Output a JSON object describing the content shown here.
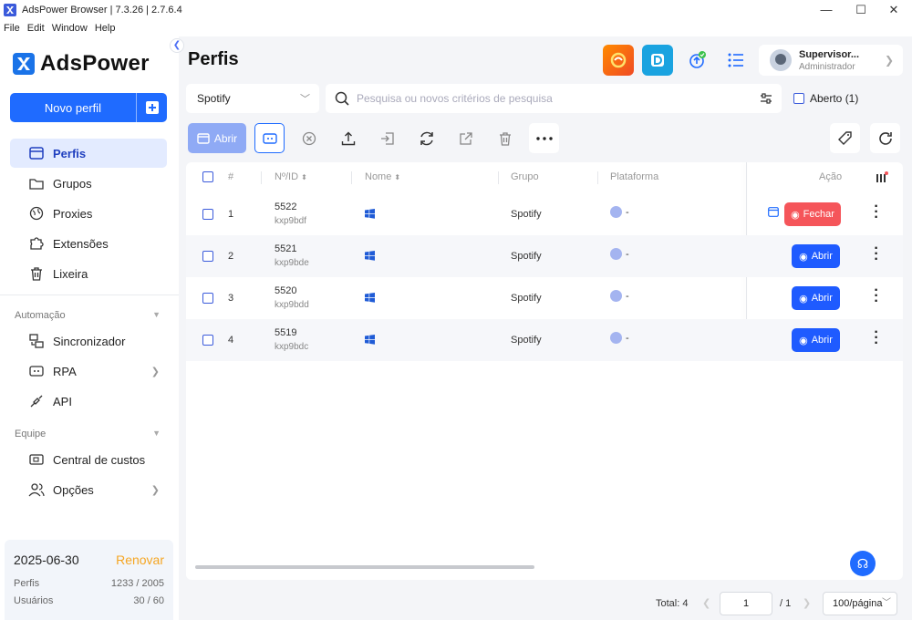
{
  "window": {
    "title": "AdsPower Browser | 7.3.26 | 2.7.6.4",
    "minimize": "—",
    "maximize": "☐",
    "close": "✕"
  },
  "menu": [
    "File",
    "Edit",
    "Window",
    "Help"
  ],
  "sidebar": {
    "brand": "AdsPower",
    "new_profile": "Novo perfil",
    "items": [
      {
        "label": "Perfis",
        "icon": "browser-window-icon"
      },
      {
        "label": "Grupos",
        "icon": "folder-icon"
      },
      {
        "label": "Proxies",
        "icon": "globe-icon"
      },
      {
        "label": "Extensões",
        "icon": "puzzle-icon"
      },
      {
        "label": "Lixeira",
        "icon": "trash-icon"
      }
    ],
    "automation_section": "Automação",
    "automation": [
      {
        "label": "Sincronizador",
        "icon": "sync-windows-icon"
      },
      {
        "label": "RPA",
        "icon": "robot-icon"
      },
      {
        "label": "API",
        "icon": "plug-icon"
      }
    ],
    "team_section": "Equipe",
    "team": [
      {
        "label": "Central de custos",
        "icon": "wallet-icon"
      },
      {
        "label": "Opções",
        "icon": "users-icon"
      }
    ],
    "plan": {
      "expiry": "2025-06-30",
      "renew": "Renovar",
      "profiles_label": "Perfis",
      "profiles_value": "1233 / 2005",
      "users_label": "Usuários",
      "users_value": "30 / 60"
    }
  },
  "header": {
    "title": "Perfis",
    "user_name": "Supervisor...",
    "user_role": "Administrador"
  },
  "filters": {
    "group_select": "Spotify",
    "search_placeholder": "Pesquisa ou novos critérios de pesquisa",
    "opened_label": "Aberto (1)"
  },
  "toolbar": {
    "open_label": "Abrir"
  },
  "table": {
    "headers": {
      "index": "#",
      "id": "Nº/ID",
      "name": "Nome",
      "group": "Grupo",
      "platform": "Plataforma",
      "action": "Ação"
    },
    "rows": [
      {
        "index": "1",
        "number": "5522",
        "id": "kxp9bdf",
        "group": "Spotify",
        "platform": "-",
        "action": "Fechar"
      },
      {
        "index": "2",
        "number": "5521",
        "id": "kxp9bde",
        "group": "Spotify",
        "platform": "-",
        "action": "Abrir"
      },
      {
        "index": "3",
        "number": "5520",
        "id": "kxp9bdd",
        "group": "Spotify",
        "platform": "-",
        "action": "Abrir"
      },
      {
        "index": "4",
        "number": "5519",
        "id": "kxp9bdc",
        "group": "Spotify",
        "platform": "-",
        "action": "Abrir"
      }
    ]
  },
  "pagination": {
    "total": "Total: 4",
    "page": "1",
    "pages": "/ 1",
    "page_size": "100/página"
  },
  "colors": {
    "primary": "#1f6bff",
    "danger": "#f5555a",
    "renew": "#f5a623",
    "active_nav_bg": "#e3ebff"
  }
}
